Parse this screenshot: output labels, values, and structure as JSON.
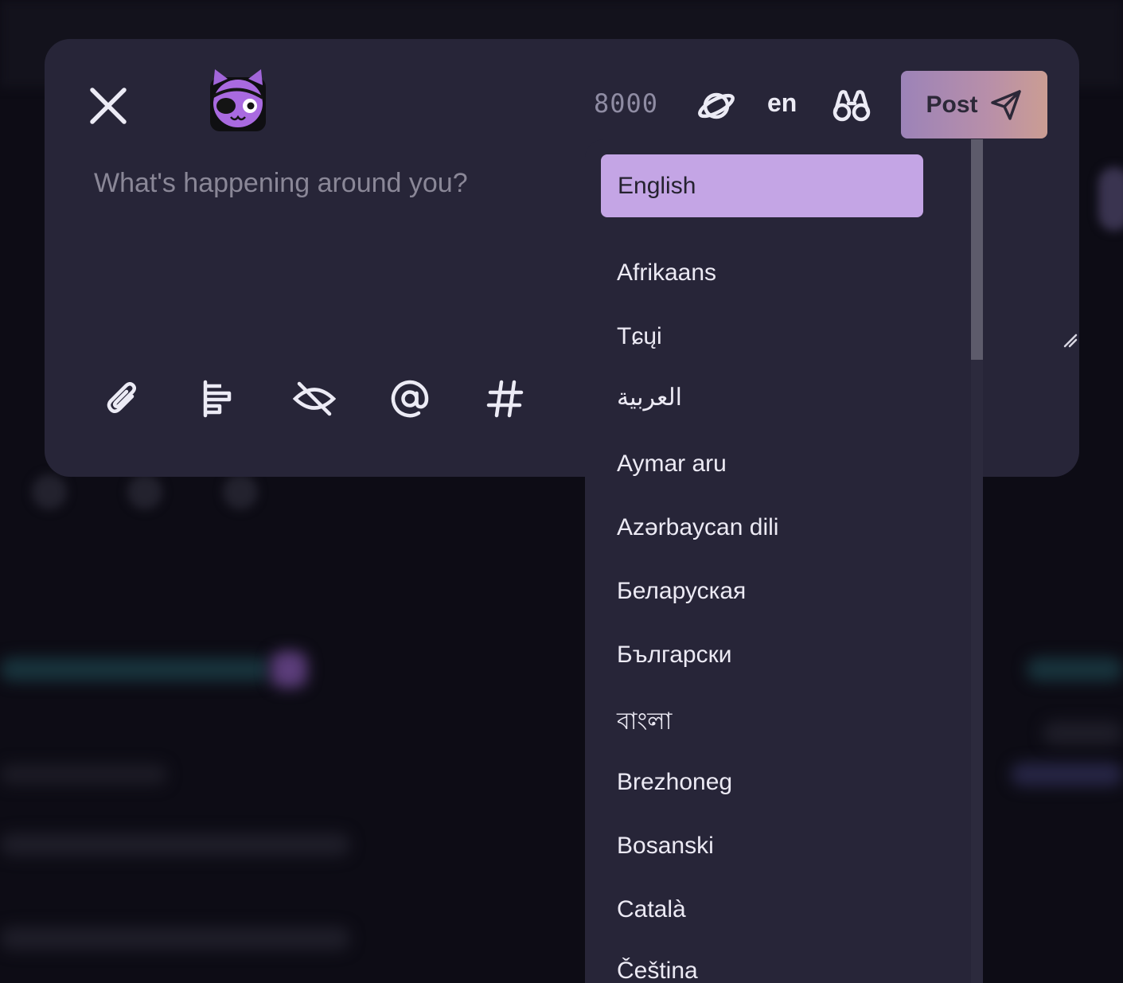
{
  "composer": {
    "placeholder": "What's happening around you?",
    "char_count": "8000",
    "language_code": "en",
    "post_label": "Post",
    "icons": {
      "close": "close-icon",
      "visibility": "globe-icon",
      "binoculars": "binoculars-icon",
      "send": "send-icon",
      "attach": "paperclip-icon",
      "poll": "poll-icon",
      "sensitive": "eye-off-icon",
      "mention": "at-icon",
      "hashtag": "hashtag-icon"
    }
  },
  "language_menu": {
    "selected": "English",
    "items": [
      "Afrikaans",
      "Tɕųi",
      "العربية",
      "Aymar aru",
      "Azərbaycan dili",
      "Беларуская",
      "Български",
      "বাংলা",
      "Brezhoneg",
      "Bosanski",
      "Català",
      "Čeština"
    ]
  },
  "colors": {
    "background": "#0d0c15",
    "panel": "#272538",
    "selected_item": "#c4a5e5",
    "post_gradient_start": "#9c83b8",
    "post_gradient_end": "#cb9d93"
  }
}
